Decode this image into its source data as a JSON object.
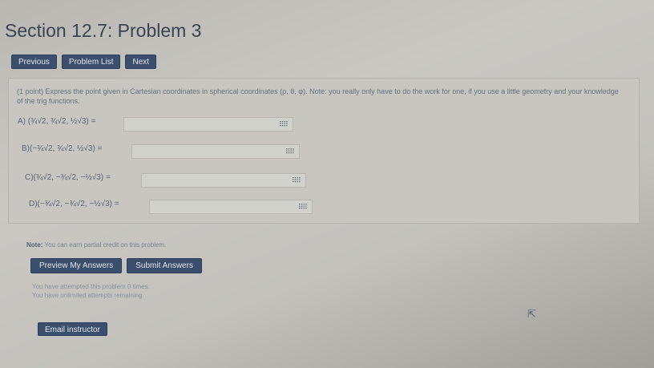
{
  "page": {
    "title": "Section 12.7: Problem 3"
  },
  "nav": {
    "previous": "Previous",
    "problem_list": "Problem List",
    "next": "Next"
  },
  "problem": {
    "statement": "(1 point) Express the point given in Cartesian coordinates in spherical coordinates (ρ, θ, φ). Note: you really only have to do the work for one, if you use a little geometry and your knowledge of the trig functions.",
    "parts": [
      {
        "label": "A) (¾√2, ¾√2, ½√3) =",
        "value": ""
      },
      {
        "label": "B)(−¾√2, ¾√2, ½√3) =",
        "value": ""
      },
      {
        "label": "C)(¾√2, −¾√2, −½√3) =",
        "value": ""
      },
      {
        "label": "D)(−¾√2, −¾√2, −½√3) =",
        "value": ""
      }
    ],
    "answer_tool_icon": "grid-icon"
  },
  "note": {
    "label": "Note:",
    "text": "You can earn partial credit on this problem."
  },
  "actions": {
    "preview": "Preview My Answers",
    "submit": "Submit Answers"
  },
  "status": {
    "attempted": "You have attempted this problem 0 times.",
    "remaining": "You have unlimited attempts remaining."
  },
  "email": {
    "label": "Email instructor"
  },
  "colors": {
    "button": "#3b4e6b",
    "background": "#c4c3be"
  }
}
